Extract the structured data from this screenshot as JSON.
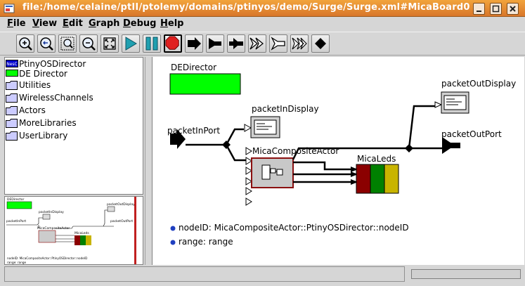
{
  "window": {
    "title": "file:/home/celaine/ptII/ptolemy/domains/ptinyos/demo/Surge/Surge.xml#MicaBoard0"
  },
  "menu": [
    {
      "label": "File",
      "mnemonic": "F"
    },
    {
      "label": "View",
      "mnemonic": "V"
    },
    {
      "label": "Edit",
      "mnemonic": "E"
    },
    {
      "label": "Graph",
      "mnemonic": "G"
    },
    {
      "label": "Debug",
      "mnemonic": "D"
    },
    {
      "label": "Help",
      "mnemonic": "H"
    }
  ],
  "toolbar": [
    {
      "icon": "zoom-in-icon"
    },
    {
      "icon": "zoom-reset-icon"
    },
    {
      "icon": "zoom-fit-icon"
    },
    {
      "icon": "zoom-out-icon"
    },
    {
      "icon": "full-screen-icon"
    },
    {
      "icon": "run-icon"
    },
    {
      "icon": "pause-icon"
    },
    {
      "icon": "stop-icon"
    },
    {
      "icon": "input-port-icon"
    },
    {
      "icon": "output-port-icon"
    },
    {
      "icon": "input-output-port-icon"
    },
    {
      "icon": "multiport-input-icon"
    },
    {
      "icon": "multiport-output-icon"
    },
    {
      "icon": "multiport-inout-icon"
    },
    {
      "icon": "relation-icon"
    }
  ],
  "library": {
    "items": [
      {
        "label": "PtinyOSDirector",
        "icon": "director-icon",
        "color": "#0000cc"
      },
      {
        "label": "DE Director",
        "icon": "director-icon",
        "color": "#00ff00"
      },
      {
        "label": "Utilities",
        "icon": "folder-icon"
      },
      {
        "label": "WirelessChannels",
        "icon": "folder-icon"
      },
      {
        "label": "Actors",
        "icon": "folder-icon"
      },
      {
        "label": "MoreLibraries",
        "icon": "folder-icon"
      },
      {
        "label": "UserLibrary",
        "icon": "folder-icon"
      }
    ]
  },
  "canvas": {
    "director": {
      "label": "DEDirector",
      "color": "#00ff00"
    },
    "packetInDisplay": "packetInDisplay",
    "packetInPort": "packetInPort",
    "packetOutDisplay": "packetOutDisplay",
    "packetOutPort": "packetOutPort",
    "composite": "MicaCompositeActor",
    "leds": {
      "label": "MicaLeds",
      "colors": [
        "#8b0000",
        "#008000",
        "#c8b400"
      ]
    },
    "params": [
      {
        "name": "nodeID",
        "value": "MicaCompositeActor::PtinyOSDirector::nodeID",
        "text": "nodeID: MicaCompositeActor::PtinyOSDirector::nodeID"
      },
      {
        "name": "range",
        "value": "range",
        "text": "range: range"
      }
    ]
  },
  "overview": {
    "director": "DEDirector",
    "packetInDisplay": "packetInDisplay",
    "packetInPort": "packetInPort",
    "packetOutDisplay": "packetOutDisplay",
    "packetOutPort": "packetOutPort",
    "composite": "MicaCompositeActor",
    "leds": "MicaLeds",
    "param1": "nodeID: MicaCompositeActor::PtinyOSDirector::nodeID",
    "param2": "range: range"
  },
  "status": {
    "message": "",
    "progress": 0
  }
}
